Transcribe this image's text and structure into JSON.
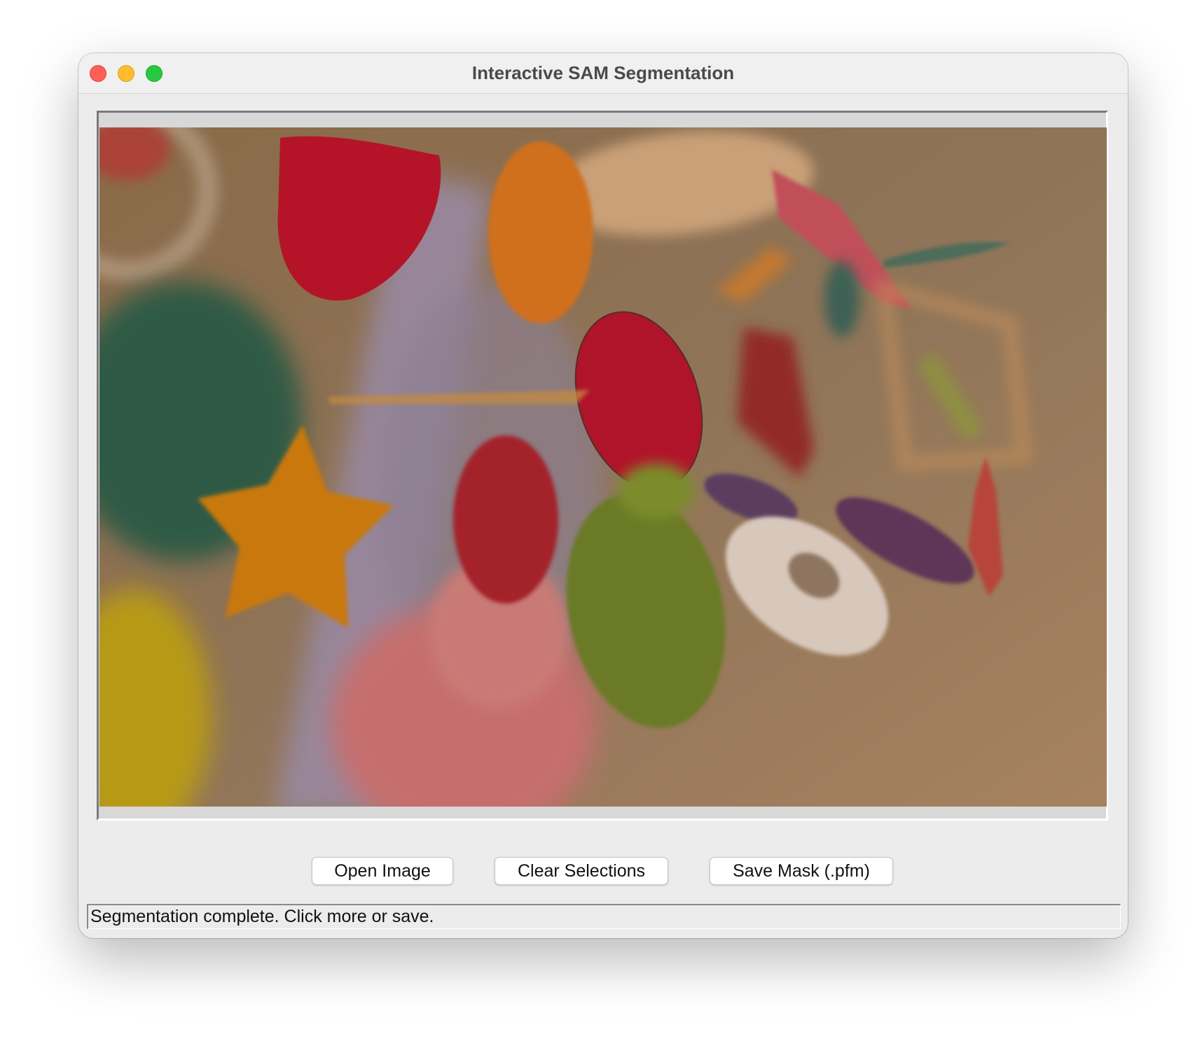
{
  "window": {
    "title": "Interactive SAM Segmentation"
  },
  "toolbar": {
    "open_label": "Open Image",
    "clear_label": "Clear Selections",
    "save_label": "Save Mask (.pfm)"
  },
  "status": {
    "text": "Segmentation complete. Click more or save."
  },
  "colors": {
    "window_bg": "#ececec",
    "close": "#fe5f57",
    "minimize": "#febc2e",
    "maximize": "#28c840"
  },
  "icons": {
    "close": "close-traffic-light-icon",
    "minimize": "minimize-traffic-light-icon",
    "maximize": "maximize-traffic-light-icon"
  }
}
